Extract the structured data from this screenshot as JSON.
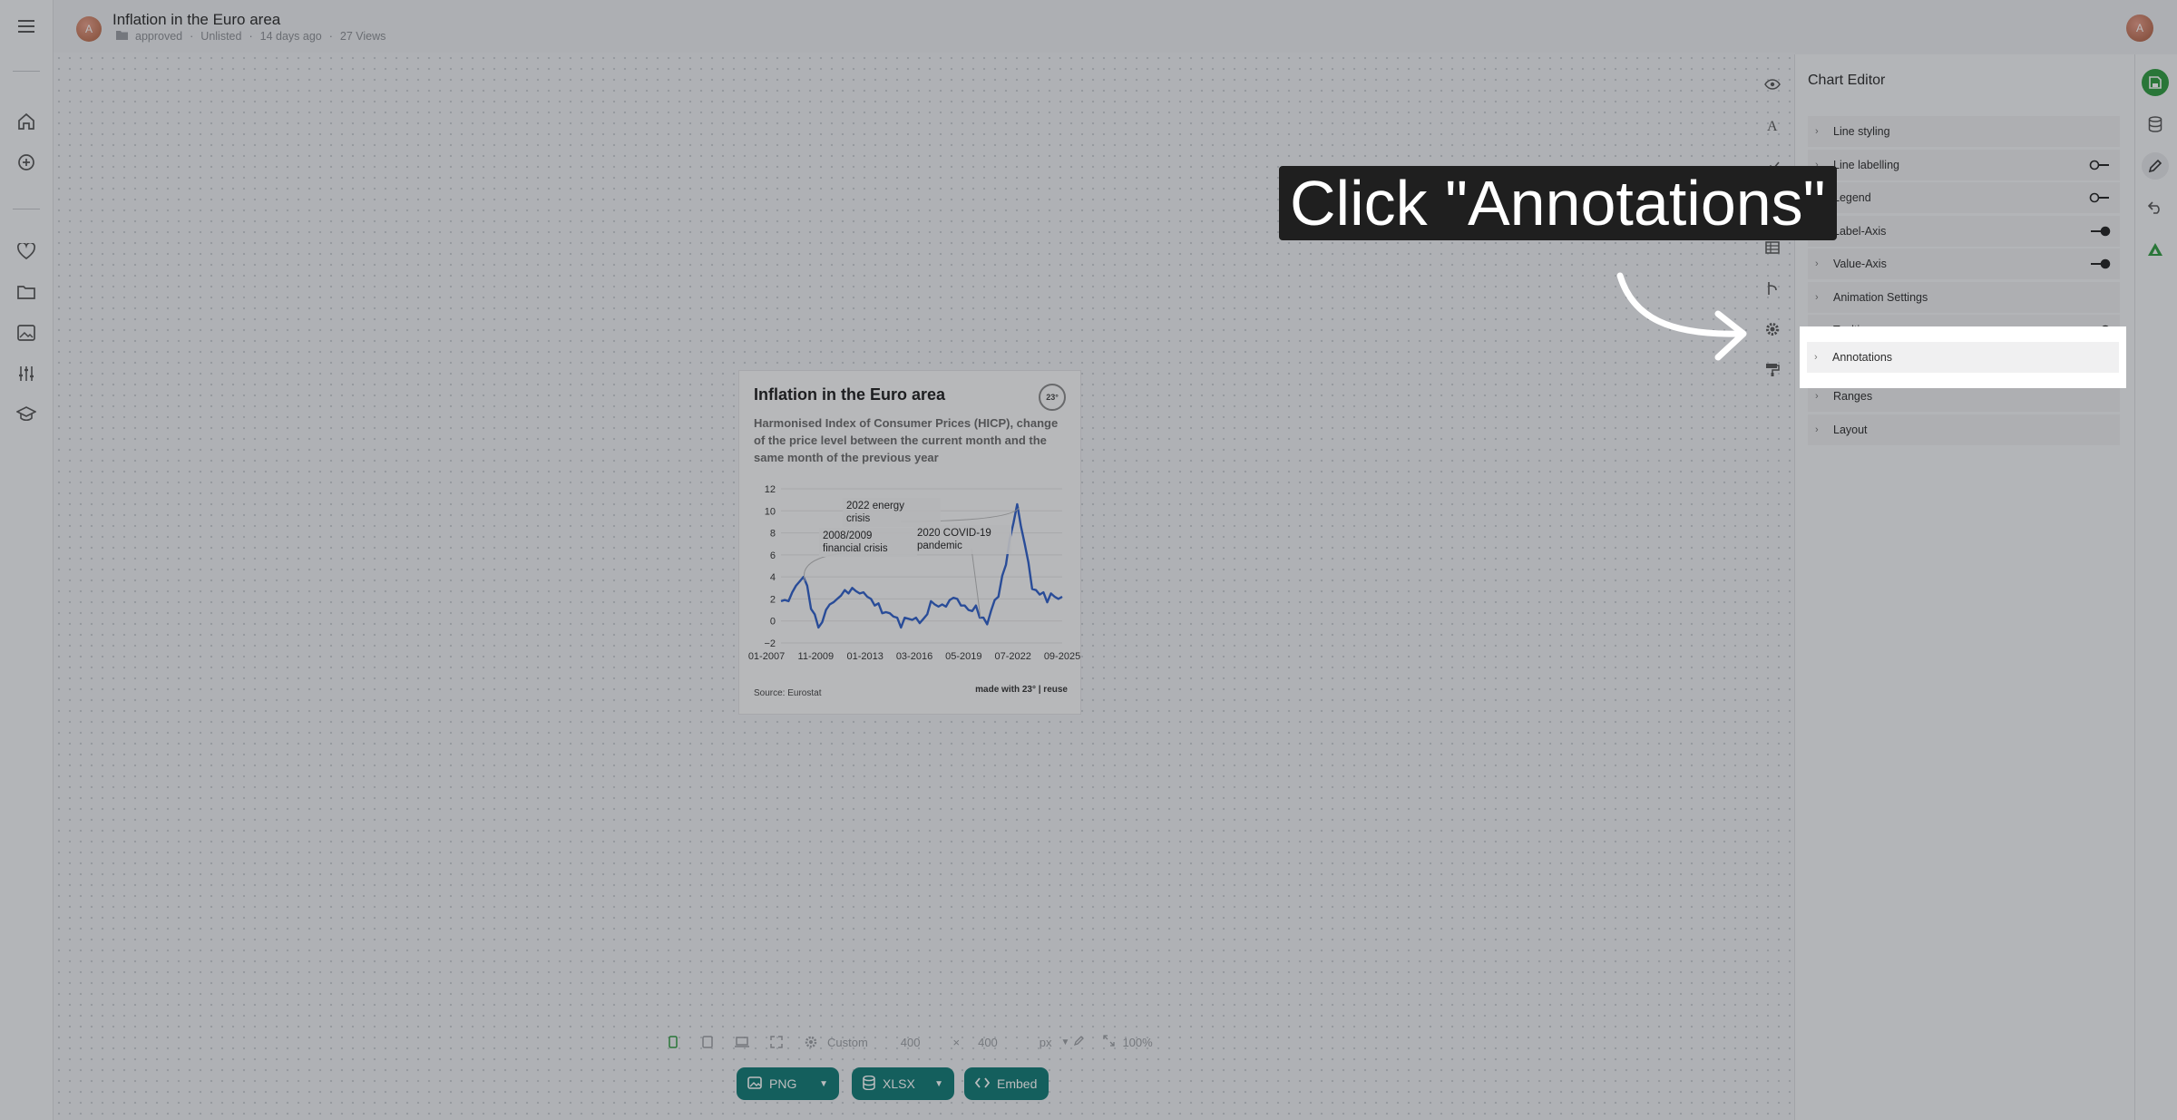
{
  "header": {
    "avatar_initial": "A",
    "title": "Inflation in the Euro area",
    "meta": {
      "folder": "approved",
      "visibility": "Unlisted",
      "age": "14 days ago",
      "views": "27 Views"
    },
    "user_initial": "A"
  },
  "left_rail": {
    "items": [
      "menu-icon",
      "home-icon",
      "add-icon",
      "heart-icon",
      "folder-icon",
      "image-icon",
      "sliders-icon",
      "graduation-cap-icon"
    ]
  },
  "chart_card": {
    "title": "Inflation in the Euro area",
    "subtitle": "Harmonised Index of Consumer Prices (HICP), change of the price level between the current month and the same month of the previous year",
    "logo_text": "23°",
    "source": "Source: Eurostat",
    "made_with": "made with 23° | reuse"
  },
  "chart_data": {
    "type": "line",
    "title": "Inflation in the Euro area",
    "subtitle": "Harmonised Index of Consumer Prices (HICP), change of the price level between the current month and the same month of the previous year",
    "xlabel": "",
    "ylabel": "",
    "ylim": [
      -2,
      12
    ],
    "y_ticks": [
      -2,
      0,
      2,
      4,
      6,
      8,
      10,
      12
    ],
    "x_tick_labels": [
      "01-2007",
      "11-2009",
      "01-2013",
      "03-2016",
      "05-2019",
      "07-2022",
      "09-2025"
    ],
    "grid": true,
    "series": [
      {
        "color": "#2f5fc9",
        "x": [
          2007.0,
          2007.25,
          2007.5,
          2007.75,
          2008.0,
          2008.25,
          2008.5,
          2008.75,
          2009.0,
          2009.25,
          2009.5,
          2009.75,
          2010.0,
          2010.25,
          2010.5,
          2010.75,
          2011.0,
          2011.25,
          2011.5,
          2011.75,
          2012.0,
          2012.25,
          2012.5,
          2012.75,
          2013.0,
          2013.25,
          2013.5,
          2013.75,
          2014.0,
          2014.25,
          2014.5,
          2014.75,
          2015.0,
          2015.25,
          2015.5,
          2015.75,
          2016.0,
          2016.25,
          2016.5,
          2016.75,
          2017.0,
          2017.25,
          2017.5,
          2017.75,
          2018.0,
          2018.25,
          2018.5,
          2018.75,
          2019.0,
          2019.25,
          2019.5,
          2019.75,
          2020.0,
          2020.25,
          2020.5,
          2020.75,
          2021.0,
          2021.25,
          2021.5,
          2021.75,
          2022.0,
          2022.25,
          2022.5,
          2022.75,
          2023.0,
          2023.25,
          2023.5,
          2023.75,
          2024.0,
          2024.25,
          2024.5,
          2024.75,
          2025.0,
          2025.25,
          2025.5,
          2025.75
        ],
        "values": [
          1.8,
          1.9,
          1.8,
          2.6,
          3.2,
          3.6,
          4.0,
          3.2,
          1.1,
          0.6,
          -0.6,
          -0.1,
          1.0,
          1.5,
          1.7,
          2.0,
          2.3,
          2.8,
          2.5,
          3.0,
          2.7,
          2.5,
          2.6,
          2.2,
          2.0,
          1.4,
          1.6,
          0.7,
          0.8,
          0.7,
          0.4,
          0.3,
          -0.6,
          0.3,
          0.2,
          0.1,
          0.3,
          -0.2,
          0.2,
          0.6,
          1.8,
          1.5,
          1.3,
          1.5,
          1.3,
          1.9,
          2.1,
          2.0,
          1.4,
          1.4,
          1.0,
          0.9,
          1.4,
          0.3,
          0.3,
          -0.3,
          0.9,
          1.9,
          2.2,
          4.1,
          5.1,
          7.4,
          8.9,
          10.6,
          8.6,
          7.0,
          5.3,
          2.9,
          2.8,
          2.4,
          2.6,
          1.7,
          2.5,
          2.2,
          2.0,
          2.2
        ]
      }
    ],
    "annotations": [
      {
        "text_lines": [
          "2022 energy",
          "crisis"
        ],
        "x": 2022.9
      },
      {
        "text_lines": [
          "2008/2009",
          "financial crisis"
        ],
        "x": 2008.6
      },
      {
        "text_lines": [
          "2020 COVID-19",
          "pandemic"
        ],
        "x": 2020.3
      }
    ]
  },
  "size_bar": {
    "preset": "Custom",
    "width": "400",
    "times": "×",
    "height": "400",
    "unit": "px",
    "zoom": "100%"
  },
  "export": {
    "png": "PNG",
    "xlsx": "XLSX",
    "embed": "Embed"
  },
  "editor": {
    "title": "Chart Editor",
    "sections": [
      {
        "label": "Line styling",
        "toggle": null
      },
      {
        "label": "Line labelling",
        "toggle": "off"
      },
      {
        "label": "Legend",
        "toggle": "off"
      },
      {
        "label": "Label-Axis",
        "toggle": "on"
      },
      {
        "label": "Value-Axis",
        "toggle": "on"
      },
      {
        "label": "Animation Settings",
        "toggle": null
      },
      {
        "label": "Tooltip",
        "toggle": "on"
      },
      {
        "label": "Annotations",
        "toggle": null
      },
      {
        "label": "Ranges",
        "toggle": null
      },
      {
        "label": "Layout",
        "toggle": null
      }
    ]
  },
  "tutorial": {
    "callout": "Click \"Annotations\"",
    "highlight_label": "Annotations"
  },
  "colors": {
    "accent": "#117a74",
    "save_green": "#2e9b3f",
    "line_blue": "#2f5fc9"
  }
}
